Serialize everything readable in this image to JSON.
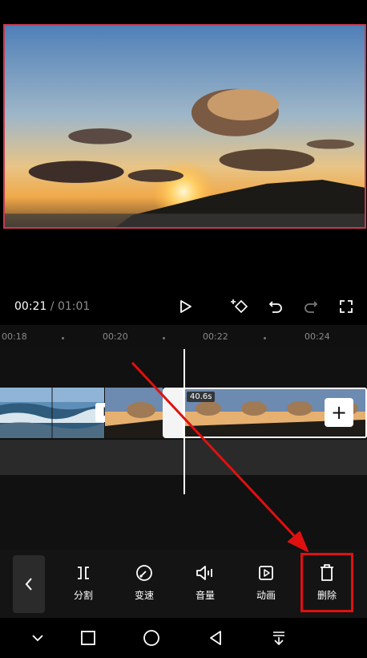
{
  "player": {
    "current_time": "00:21",
    "separator": " / ",
    "total_time": "01:01"
  },
  "ruler": {
    "ticks": [
      "00:18",
      "00:20",
      "00:22",
      "00:24"
    ]
  },
  "timeline": {
    "clip_duration": "40.6s",
    "add_clip_symbol": "+"
  },
  "toolbar": {
    "back_icon": "chevron-left-icon",
    "items": [
      {
        "label": "分割",
        "icon": "split-icon"
      },
      {
        "label": "变速",
        "icon": "speed-icon"
      },
      {
        "label": "音量",
        "icon": "volume-icon"
      },
      {
        "label": "动画",
        "icon": "animation-icon"
      },
      {
        "label": "删除",
        "icon": "trash-icon"
      }
    ]
  },
  "colors": {
    "highlight": "#e01010",
    "arrow": "#e01010",
    "frame_border": "#c53a4f"
  }
}
